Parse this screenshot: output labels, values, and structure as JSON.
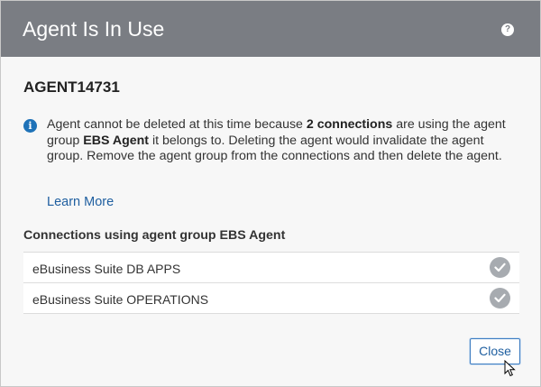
{
  "dialog": {
    "title": "Agent Is In Use",
    "help_icon": "question-circle-icon",
    "help_glyph": "?"
  },
  "agent": {
    "name": "AGENT14731"
  },
  "message": {
    "info_icon": "info-circle-icon",
    "info_glyph": "i",
    "part1": "Agent cannot be deleted at this time because ",
    "bold1": "2 connections",
    "part2": " are using the agent group ",
    "bold2": "EBS Agent",
    "part3": " it belongs to. Deleting the agent would invalidate the agent group. Remove the agent group from the connections and then delete the agent."
  },
  "learn_more": "Learn More",
  "connections": {
    "title": "Connections using agent group EBS Agent",
    "items": [
      {
        "label": "eBusiness Suite DB APPS",
        "status_icon": "check-circle-icon"
      },
      {
        "label": "eBusiness Suite OPERATIONS",
        "status_icon": "check-circle-icon"
      }
    ]
  },
  "footer": {
    "close_label": "Close"
  },
  "colors": {
    "header_bg": "#7a7d83",
    "link": "#1f5fa0",
    "info_blue": "#1e72b8",
    "check_gray": "#a7abb0"
  }
}
